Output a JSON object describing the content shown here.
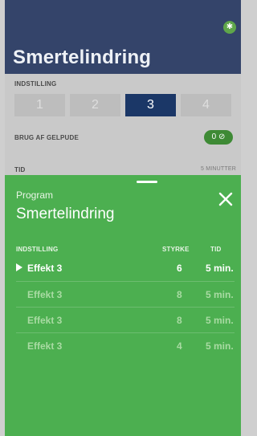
{
  "app": {
    "title": "Smertelindring",
    "bluetooth_icon": "bluetooth-icon"
  },
  "background": {
    "indstilling_label": "INDSTILLING",
    "segments": [
      "1",
      "2",
      "3",
      "4"
    ],
    "selected_segment": "3",
    "gel_label": "BRUG AF GELPUDE",
    "gel_value": "0",
    "tid_label": "TID",
    "tid_value": "5 MINUTTER"
  },
  "sheet": {
    "subtitle": "Program",
    "title": "Smertelindring",
    "close_icon": "close-icon",
    "table": {
      "headers": {
        "setting": "INDSTILLING",
        "strength": "STYRKE",
        "time": "TID"
      },
      "rows": [
        {
          "name": "Effekt 3",
          "strength": "6",
          "time": "5 min.",
          "selected": true
        },
        {
          "name": "Effekt 3",
          "strength": "8",
          "time": "5 min.",
          "selected": false
        },
        {
          "name": "Effekt 3",
          "strength": "8",
          "time": "5 min.",
          "selected": false
        },
        {
          "name": "Effekt 3",
          "strength": "4",
          "time": "5 min.",
          "selected": false
        }
      ]
    }
  },
  "colors": {
    "header_bg": "#34446a",
    "sheet_green": "#4caf50",
    "selected_segment": "#1b3767"
  }
}
